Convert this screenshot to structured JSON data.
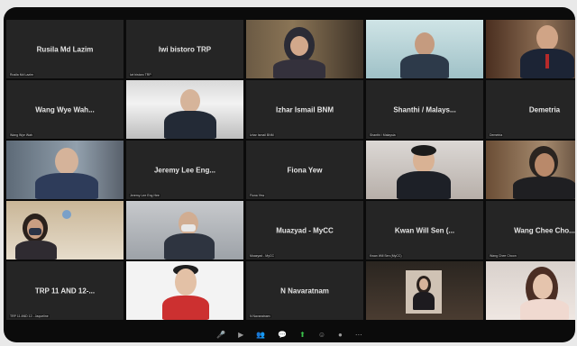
{
  "meeting": {
    "tiles": [
      {
        "name": "Rusila Md Lazim",
        "caption": "Rusila Md Lazim"
      },
      {
        "name": "Iwi bistoro TRP",
        "caption": "Iwi bistoro TRP"
      },
      {
        "name": "",
        "caption": "",
        "video": true
      },
      {
        "name": "",
        "caption": "",
        "video": true,
        "active": true
      },
      {
        "name": "",
        "caption": "",
        "video": true
      },
      {
        "name": "Wang Wye Wah...",
        "caption": "Wang Wye Wah"
      },
      {
        "name": "",
        "caption": "",
        "video": true
      },
      {
        "name": "Izhar Ismail BNM",
        "caption": "Izhar Ismail BNM"
      },
      {
        "name": "Shanthi / Malays...",
        "caption": "Shanthi / Malaysia"
      },
      {
        "name": "Demetria",
        "caption": "Demetria"
      },
      {
        "name": "",
        "caption": "",
        "video": true
      },
      {
        "name": "Jeremy Lee Eng...",
        "caption": "Jeremy Lee Eng Hee"
      },
      {
        "name": "Fiona Yew",
        "caption": "Fiona Yew"
      },
      {
        "name": "",
        "caption": "",
        "video": true
      },
      {
        "name": "",
        "caption": "",
        "video": true
      },
      {
        "name": "",
        "caption": "",
        "video": true
      },
      {
        "name": "",
        "caption": "",
        "video": true
      },
      {
        "name": "Muazyad - MyCC",
        "caption": "Muazyad - MyCC"
      },
      {
        "name": "Kwan Will Sen (...",
        "caption": "Kwan Will Sen (MyCC)"
      },
      {
        "name": "Wang Chee Cho...",
        "caption": "Wang Chee Choon"
      },
      {
        "name": "TRP 11 AND 12-...",
        "caption": "TRP 11 AND 12 - Jaqueline"
      },
      {
        "name": "",
        "caption": "",
        "video": true
      },
      {
        "name": "N Navaratnam",
        "caption": "N Navaratnam"
      },
      {
        "name": "",
        "caption": "",
        "video": true
      },
      {
        "name": "",
        "caption": "",
        "video": true
      }
    ],
    "toolbar": {
      "mute": "🎤",
      "video": "▶",
      "participants": "👥",
      "chat": "💬",
      "share": "⬆",
      "reactions": "☺",
      "record": "●",
      "more": "⋯"
    }
  }
}
